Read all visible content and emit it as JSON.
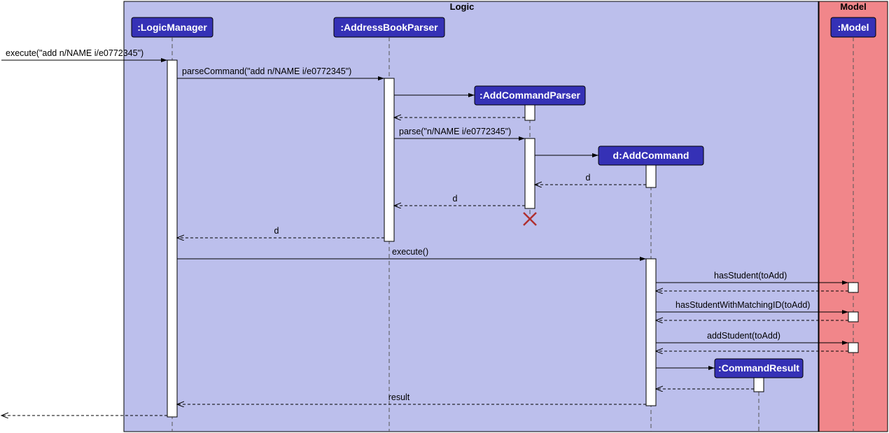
{
  "frames": {
    "logic": {
      "label": "Logic"
    },
    "model": {
      "label": "Model"
    }
  },
  "participants": {
    "logicManager": {
      "label": ":LogicManager"
    },
    "addressBookParser": {
      "label": ":AddressBookParser"
    },
    "addCommandParser": {
      "label": ":AddCommandParser"
    },
    "addCommand": {
      "label": "d:AddCommand"
    },
    "commandResult": {
      "label": ":CommandResult"
    },
    "model": {
      "label": ":Model"
    }
  },
  "messages": {
    "m1": "execute(\"add n/NAME i/e0772345\")",
    "m2": "parseCommand(\"add n/NAME i/e0772345\")",
    "m3": "parse(\"n/NAME i/e0772345\")",
    "m4": "d",
    "m5": "d",
    "m6": "d",
    "m7": "execute()",
    "m8": "hasStudent(toAdd)",
    "m9": "hasStudentWithMatchingID(toAdd)",
    "m10": "addStudent(toAdd)",
    "m11": "result"
  },
  "chart_data": {
    "type": "uml-sequence-diagram",
    "frames": [
      {
        "name": "Logic",
        "participants": [
          "LogicManager",
          "AddressBookParser",
          "AddCommandParser",
          "AddCommand",
          "CommandResult"
        ]
      },
      {
        "name": "Model",
        "participants": [
          "Model"
        ]
      }
    ],
    "participants": [
      {
        "id": "external",
        "label": "",
        "created": "pre"
      },
      {
        "id": "LogicManager",
        "label": ":LogicManager",
        "created": "pre"
      },
      {
        "id": "AddressBookParser",
        "label": ":AddressBookParser",
        "created": "pre"
      },
      {
        "id": "AddCommandParser",
        "label": ":AddCommandParser",
        "created": "runtime",
        "destroyed": true
      },
      {
        "id": "AddCommand",
        "label": "d:AddCommand",
        "created": "runtime"
      },
      {
        "id": "CommandResult",
        "label": ":CommandResult",
        "created": "runtime"
      },
      {
        "id": "Model",
        "label": ":Model",
        "created": "pre"
      }
    ],
    "messages": [
      {
        "from": "external",
        "to": "LogicManager",
        "label": "execute(\"add n/NAME i/e0772345\")",
        "kind": "sync"
      },
      {
        "from": "LogicManager",
        "to": "AddressBookParser",
        "label": "parseCommand(\"add n/NAME i/e0772345\")",
        "kind": "sync"
      },
      {
        "from": "AddressBookParser",
        "to": "AddCommandParser",
        "label": "",
        "kind": "create"
      },
      {
        "from": "AddCommandParser",
        "to": "AddressBookParser",
        "label": "",
        "kind": "return"
      },
      {
        "from": "AddressBookParser",
        "to": "AddCommandParser",
        "label": "parse(\"n/NAME i/e0772345\")",
        "kind": "sync"
      },
      {
        "from": "AddCommandParser",
        "to": "AddCommand",
        "label": "",
        "kind": "create"
      },
      {
        "from": "AddCommand",
        "to": "AddCommandParser",
        "label": "d",
        "kind": "return"
      },
      {
        "from": "AddCommandParser",
        "to": "AddressBookParser",
        "label": "d",
        "kind": "return"
      },
      {
        "from": "AddCommandParser",
        "to": null,
        "label": "",
        "kind": "destroy"
      },
      {
        "from": "AddressBookParser",
        "to": "LogicManager",
        "label": "d",
        "kind": "return"
      },
      {
        "from": "LogicManager",
        "to": "AddCommand",
        "label": "execute()",
        "kind": "sync"
      },
      {
        "from": "AddCommand",
        "to": "Model",
        "label": "hasStudent(toAdd)",
        "kind": "sync"
      },
      {
        "from": "Model",
        "to": "AddCommand",
        "label": "",
        "kind": "return"
      },
      {
        "from": "AddCommand",
        "to": "Model",
        "label": "hasStudentWithMatchingID(toAdd)",
        "kind": "sync"
      },
      {
        "from": "Model",
        "to": "AddCommand",
        "label": "",
        "kind": "return"
      },
      {
        "from": "AddCommand",
        "to": "Model",
        "label": "addStudent(toAdd)",
        "kind": "sync"
      },
      {
        "from": "Model",
        "to": "AddCommand",
        "label": "",
        "kind": "return"
      },
      {
        "from": "AddCommand",
        "to": "CommandResult",
        "label": "",
        "kind": "create"
      },
      {
        "from": "CommandResult",
        "to": "AddCommand",
        "label": "",
        "kind": "return"
      },
      {
        "from": "AddCommand",
        "to": "LogicManager",
        "label": "result",
        "kind": "return"
      },
      {
        "from": "LogicManager",
        "to": "external",
        "label": "",
        "kind": "return"
      }
    ]
  }
}
